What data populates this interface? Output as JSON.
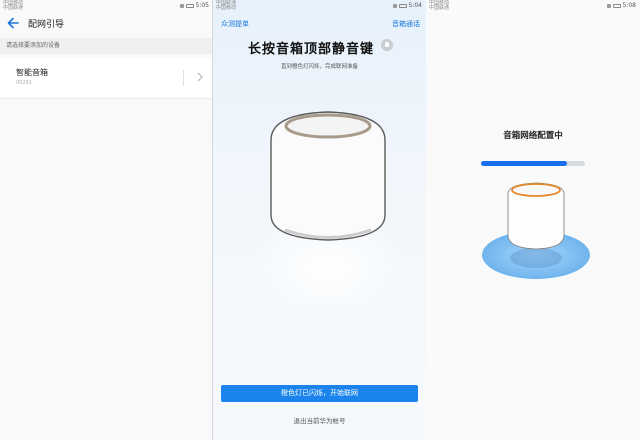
{
  "status_bars": [
    {
      "carrier": "中国移动\n中国联通",
      "time": "5:05"
    },
    {
      "carrier": "中国联通\n中国移动",
      "time": "5:04"
    },
    {
      "carrier": "中国移动\n中国联通",
      "time": "5:08"
    }
  ],
  "panel1": {
    "title": "配网引导",
    "hint": "请选择要添加的设备",
    "device": {
      "name": "智能音箱",
      "id": "00291"
    },
    "icons": {
      "back": "back-arrow-icon",
      "chevron": "chevron-right-icon"
    }
  },
  "panel2": {
    "left_link": "众测提单",
    "right_link": "音箱通话",
    "title": "长按音箱顶部静音键",
    "subtitle": "直到橙色灯闪烁，完成联网准备",
    "button": "橙色灯已闪烁，开始联网",
    "exit_link": "退出当前华为帐号",
    "colors": {
      "accent": "#1a84ec",
      "ring": "#a89a8a"
    }
  },
  "panel3": {
    "title": "音箱网络配置中",
    "progress": 0.83,
    "colors": {
      "bar": "#1a6ff0",
      "ring": "#e8882b",
      "halo": "#7fc0f2"
    }
  }
}
